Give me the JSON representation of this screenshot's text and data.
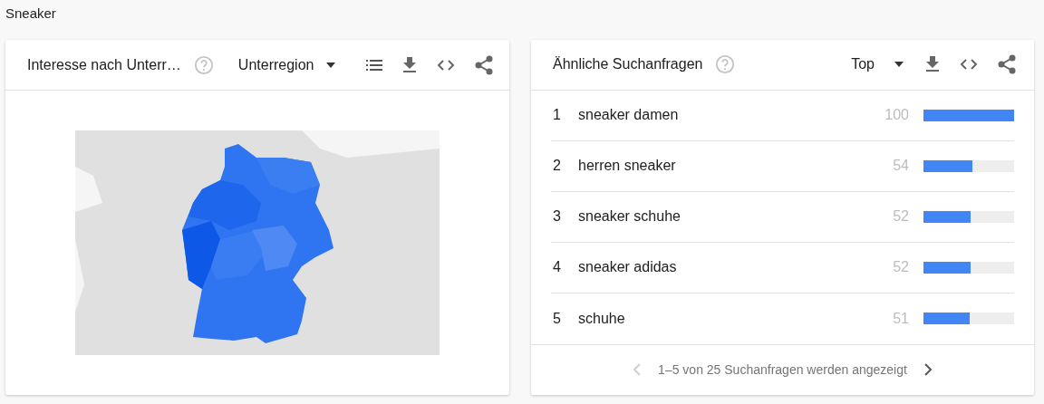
{
  "page_title": "Sneaker",
  "region_card": {
    "title": "Interesse nach Unterr…",
    "dropdown": "Unterregion"
  },
  "queries_card": {
    "title": "Ähnliche Suchanfragen",
    "dropdown": "Top",
    "rows": [
      {
        "rank": "1",
        "term": "sneaker damen",
        "value": "100",
        "level": 1
      },
      {
        "rank": "2",
        "term": "herren sneaker",
        "value": "54",
        "level": 0.54
      },
      {
        "rank": "3",
        "term": "sneaker schuhe",
        "value": "52",
        "level": 0.52
      },
      {
        "rank": "4",
        "term": "sneaker adidas",
        "value": "52",
        "level": 0.52
      },
      {
        "rank": "5",
        "term": "schuhe",
        "value": "51",
        "level": 0.51
      }
    ],
    "pagination": {
      "text": "1–5 von 25 Suchanfragen werden angezeigt",
      "prev_disabled": true,
      "next_disabled": false
    }
  }
}
